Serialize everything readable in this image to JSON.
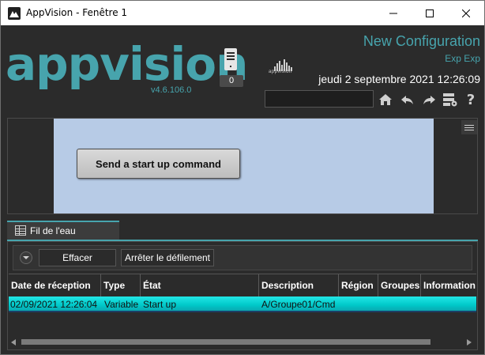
{
  "window": {
    "title": "AppVision - Fenêtre 1"
  },
  "header": {
    "logo_text": "appvision",
    "version": "v4.6.106.0",
    "server_count": "0",
    "small_logo_text": "appvision",
    "config_title": "New Configuration",
    "config_subtitle": "Exp Exp",
    "datetime": "jeudi 2 septembre 2021 12:26:09",
    "search_value": "",
    "toolbar_icons": [
      "home-icon",
      "undo-arrow-icon",
      "redo-arrow-icon",
      "server-settings-icon",
      "help-icon"
    ]
  },
  "canvas": {
    "command_button_label": "Send a start up command",
    "background_color": "#b7cbe6"
  },
  "log": {
    "tab_label": "Fil de l'eau",
    "clear_label": "Effacer",
    "stop_scroll_label": "Arrêter le défilement",
    "columns": [
      "Date de réception",
      "Type",
      "État",
      "Description",
      "Région",
      "Groupes",
      "Information"
    ],
    "rows": [
      {
        "date": "02/09/2021 12:26:04",
        "type": "Variable",
        "state": "Start up",
        "description": "A/Groupe01/Cmd",
        "region": "",
        "groups": "",
        "information": ""
      }
    ]
  },
  "colors": {
    "accent": "#47a4ad",
    "selected_row": "#00d2d2",
    "background": "#2b2b2b"
  }
}
